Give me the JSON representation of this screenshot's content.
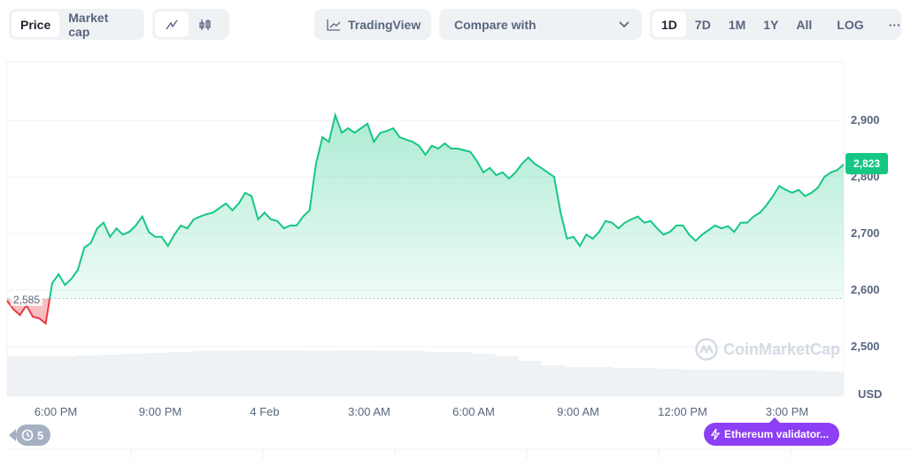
{
  "toolbar": {
    "metric_tabs": [
      {
        "label": "Price",
        "active": true
      },
      {
        "label": "Market cap",
        "active": false
      }
    ],
    "chart_types": [
      {
        "icon": "line-chart-icon",
        "active": true
      },
      {
        "icon": "candlestick-icon",
        "active": false
      }
    ],
    "tradingview_label": "TradingView",
    "compare_label": "Compare with",
    "ranges": [
      {
        "label": "1D",
        "active": true
      },
      {
        "label": "7D"
      },
      {
        "label": "1M"
      },
      {
        "label": "1Y"
      },
      {
        "label": "All"
      }
    ],
    "log_label": "LOG",
    "more_label": "···"
  },
  "colors": {
    "up": "#16c784",
    "down": "#ea3943",
    "accent": "#8c3ff4",
    "volume": "#eff2f5"
  },
  "history_badge": {
    "count": "5"
  },
  "event_badge": {
    "label": "Ethereum validator..."
  },
  "watermark": "CoinMarketCap",
  "chart_data": {
    "type": "area",
    "currency": "USD",
    "baseline": 2585,
    "baseline_label": "2,585",
    "current_price": 2823,
    "current_price_label": "2,823",
    "ylim": [
      2470,
      3000
    ],
    "yticks": [
      {
        "v": 2900,
        "label": "2,900"
      },
      {
        "v": 2800,
        "label": "2,800"
      },
      {
        "v": 2700,
        "label": "2,700"
      },
      {
        "v": 2600,
        "label": "2,600"
      },
      {
        "v": 2500,
        "label": "2,500"
      }
    ],
    "xticks": [
      "6:00 PM",
      "9:00 PM",
      "4 Feb",
      "3:00 AM",
      "6:00 AM",
      "9:00 AM",
      "12:00 PM",
      "3:00 PM"
    ],
    "grid": true,
    "values": [
      2581,
      2566,
      2556,
      2573,
      2553,
      2550,
      2541,
      2612,
      2628,
      2609,
      2620,
      2636,
      2675,
      2683,
      2709,
      2719,
      2694,
      2709,
      2698,
      2703,
      2714,
      2730,
      2703,
      2694,
      2694,
      2678,
      2698,
      2714,
      2709,
      2725,
      2730,
      2734,
      2737,
      2745,
      2753,
      2741,
      2753,
      2772,
      2766,
      2725,
      2737,
      2725,
      2722,
      2709,
      2714,
      2714,
      2730,
      2741,
      2823,
      2870,
      2862,
      2909,
      2878,
      2886,
      2878,
      2886,
      2894,
      2862,
      2878,
      2881,
      2886,
      2870,
      2866,
      2862,
      2855,
      2839,
      2855,
      2850,
      2859,
      2850,
      2850,
      2847,
      2844,
      2828,
      2808,
      2816,
      2803,
      2808,
      2797,
      2808,
      2823,
      2834,
      2823,
      2816,
      2808,
      2800,
      2737,
      2691,
      2694,
      2678,
      2698,
      2691,
      2703,
      2722,
      2719,
      2709,
      2719,
      2725,
      2730,
      2719,
      2722,
      2709,
      2698,
      2703,
      2714,
      2714,
      2698,
      2687,
      2698,
      2706,
      2714,
      2709,
      2713,
      2703,
      2719,
      2719,
      2730,
      2737,
      2750,
      2766,
      2784,
      2777,
      2772,
      2777,
      2766,
      2772,
      2781,
      2800,
      2808,
      2812,
      2822
    ],
    "volume": [
      45,
      45,
      45,
      46,
      47,
      48,
      49,
      50,
      51,
      51,
      52,
      52,
      52,
      51,
      52,
      52,
      51,
      51,
      50,
      50,
      48,
      45,
      40,
      35,
      33,
      33,
      32,
      32,
      31,
      30,
      30,
      30,
      30,
      29,
      29,
      28
    ]
  }
}
